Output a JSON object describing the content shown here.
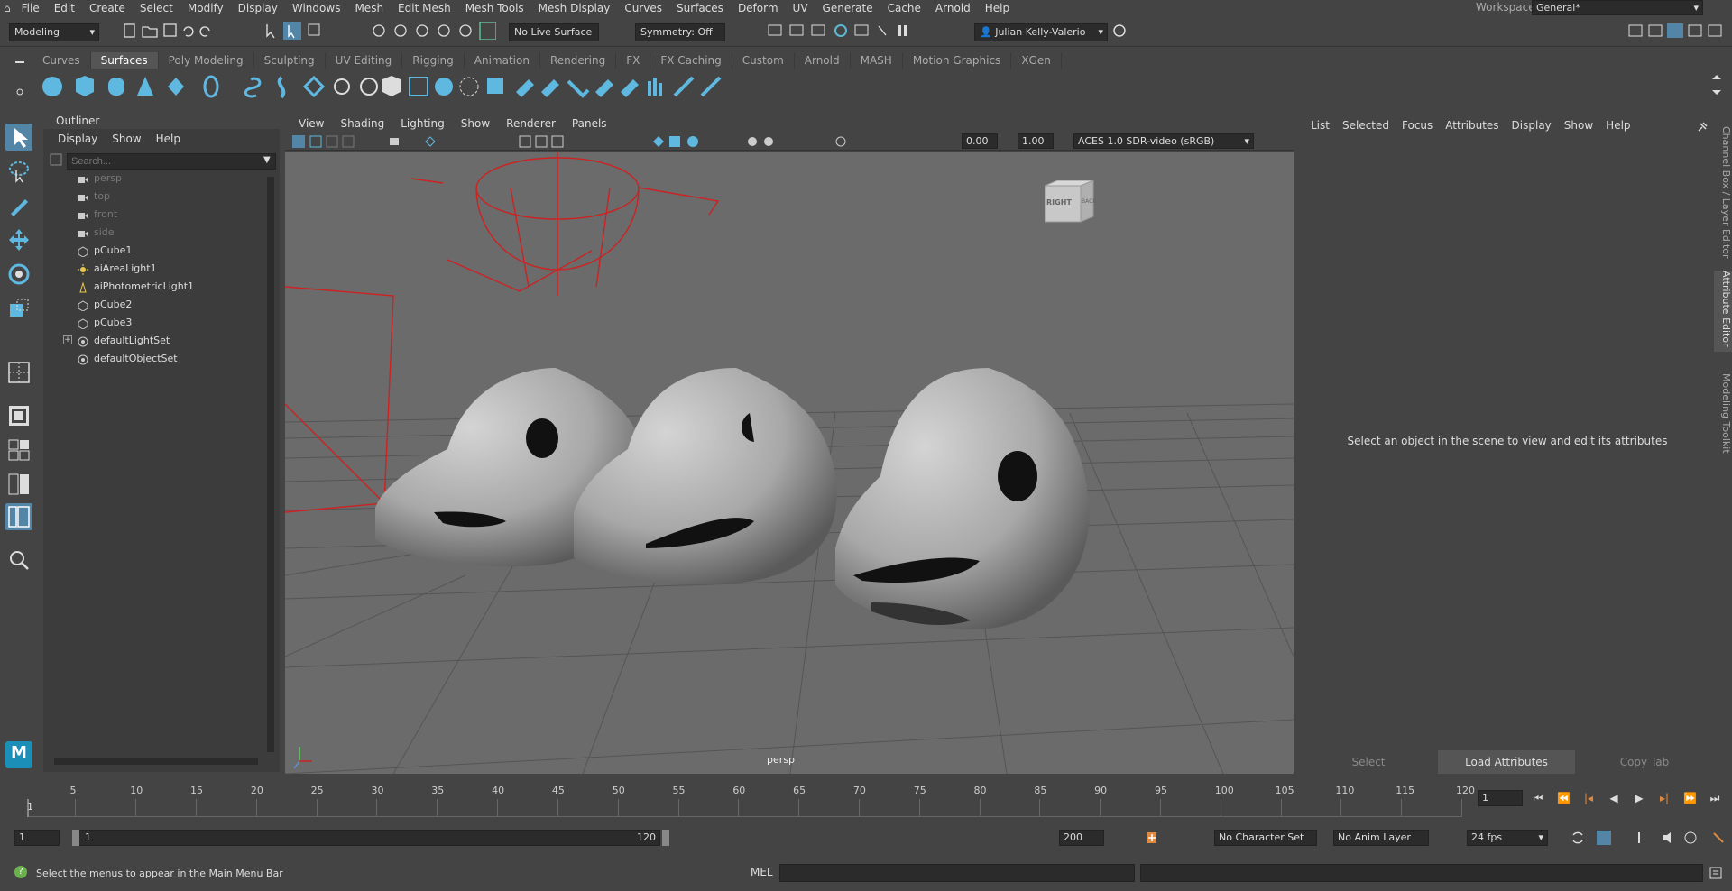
{
  "menubar": {
    "items": [
      "File",
      "Edit",
      "Create",
      "Select",
      "Modify",
      "Display",
      "Windows",
      "Mesh",
      "Edit Mesh",
      "Mesh Tools",
      "Mesh Display",
      "Curves",
      "Surfaces",
      "Deform",
      "UV",
      "Generate",
      "Cache",
      "Arnold",
      "Help"
    ],
    "workspace_label": "Workspace:",
    "workspace_value": "General*"
  },
  "statusline": {
    "mode": "Modeling",
    "live_surface": "No Live Surface",
    "symmetry": "Symmetry: Off",
    "user": "Julian Kelly-Valerio"
  },
  "shelf": {
    "tabs": [
      "Curves",
      "Surfaces",
      "Poly Modeling",
      "Sculpting",
      "UV Editing",
      "Rigging",
      "Animation",
      "Rendering",
      "FX",
      "FX Caching",
      "Custom",
      "Arnold",
      "MASH",
      "Motion Graphics",
      "XGen"
    ],
    "active_tab": "Surfaces"
  },
  "outliner": {
    "title": "Outliner",
    "menu": [
      "Display",
      "Show",
      "Help"
    ],
    "search_placeholder": "Search...",
    "items": [
      {
        "label": "persp",
        "dim": true,
        "icon": "camera-icon"
      },
      {
        "label": "top",
        "dim": true,
        "icon": "camera-icon"
      },
      {
        "label": "front",
        "dim": true,
        "icon": "camera-icon"
      },
      {
        "label": "side",
        "dim": true,
        "icon": "camera-icon"
      },
      {
        "label": "pCube1",
        "dim": false,
        "icon": "mesh-icon"
      },
      {
        "label": "aiAreaLight1",
        "dim": false,
        "icon": "light-icon"
      },
      {
        "label": "aiPhotometricLight1",
        "dim": false,
        "icon": "light-icon"
      },
      {
        "label": "pCube2",
        "dim": false,
        "icon": "mesh-icon"
      },
      {
        "label": "pCube3",
        "dim": false,
        "icon": "mesh-icon"
      },
      {
        "label": "defaultLightSet",
        "dim": false,
        "icon": "set-icon"
      },
      {
        "label": "defaultObjectSet",
        "dim": false,
        "icon": "set-icon"
      }
    ]
  },
  "viewport": {
    "menu": [
      "View",
      "Shading",
      "Lighting",
      "Show",
      "Renderer",
      "Panels"
    ],
    "exposure": "0.00",
    "gamma": "1.00",
    "color_space": "ACES 1.0 SDR-video (sRGB)",
    "camera_label": "persp",
    "viewcube_right": "RIGHT",
    "viewcube_back": "BACK"
  },
  "attribute_editor": {
    "menu": [
      "List",
      "Selected",
      "Focus",
      "Attributes",
      "Display",
      "Show",
      "Help"
    ],
    "message": "Select an object in the scene to view and edit its attributes",
    "buttons": [
      "Select",
      "Load Attributes",
      "Copy Tab"
    ]
  },
  "side_tabs": [
    "Channel Box / Layer Editor",
    "Attribute Editor",
    "Modeling Toolkit"
  ],
  "timeline": {
    "ticks": [
      "5",
      "10",
      "15",
      "20",
      "25",
      "30",
      "35",
      "40",
      "45",
      "50",
      "55",
      "60",
      "65",
      "70",
      "75",
      "80",
      "85",
      "90",
      "95",
      "100",
      "105",
      "110",
      "115",
      "120"
    ],
    "start_label": "1",
    "current_frame": "1"
  },
  "range": {
    "start": "1",
    "range_start": "1",
    "range_end": "120",
    "end": "200",
    "character_set": "No Character Set",
    "anim_layer": "No Anim Layer",
    "fps": "24 fps"
  },
  "command": {
    "help_text": "Select the menus to appear in the Main Menu Bar",
    "mel_label": "MEL"
  },
  "colors": {
    "accent": "#5285a6",
    "panel": "#444444",
    "viewport_bg": "#6b6b6b",
    "light_red": "#cc2222"
  }
}
